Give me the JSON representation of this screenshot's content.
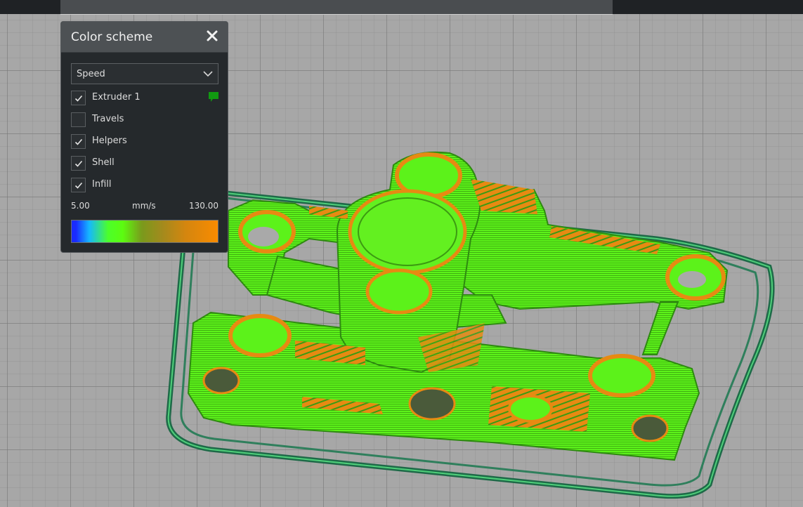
{
  "colors": {
    "extruder": "#119a11",
    "green_extrusion": "#5cf21a",
    "orange_extrusion": "#e78a12",
    "travel_teal": "#2f7f5c"
  },
  "panel": {
    "title": "Color scheme",
    "close_icon": "close-icon",
    "scheme_select": {
      "value": "Speed",
      "icon": "chevron-down-icon"
    },
    "options": [
      {
        "label": "Extruder 1",
        "checked": true
      },
      {
        "label": "Travels",
        "checked": false
      },
      {
        "label": "Helpers",
        "checked": true
      },
      {
        "label": "Shell",
        "checked": true
      },
      {
        "label": "Infill",
        "checked": true
      }
    ],
    "range": {
      "min": "5.00",
      "unit": "mm/s",
      "max": "130.00"
    }
  }
}
